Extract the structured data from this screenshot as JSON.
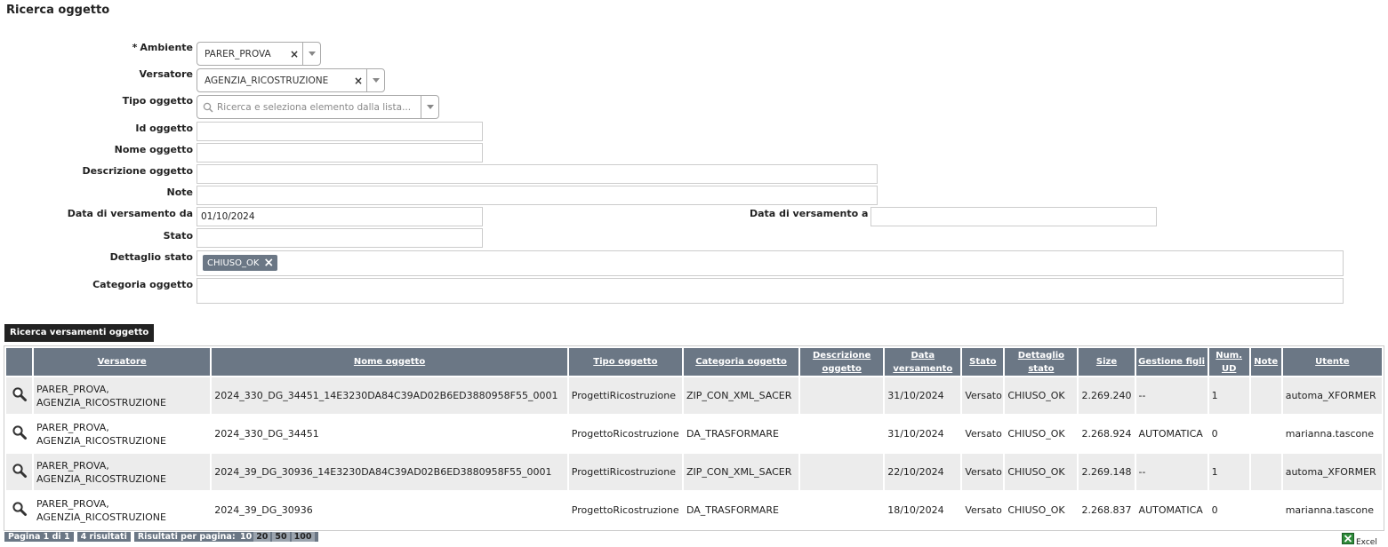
{
  "page": {
    "title": "Ricerca oggetto"
  },
  "form": {
    "ambiente": {
      "label": "Ambiente",
      "required_mark": "*",
      "value": "PARER_PROVA"
    },
    "versatore": {
      "label": "Versatore",
      "value": "AGENZIA_RICOSTRUZIONE"
    },
    "tipo_oggetto": {
      "label": "Tipo oggetto",
      "placeholder": "Ricerca e seleziona elemento dalla lista..."
    },
    "id_oggetto": {
      "label": "Id oggetto",
      "value": ""
    },
    "nome_oggetto": {
      "label": "Nome oggetto",
      "value": ""
    },
    "descrizione_oggetto": {
      "label": "Descrizione oggetto",
      "value": ""
    },
    "note": {
      "label": "Note",
      "value": ""
    },
    "data_da": {
      "label": "Data di versamento da",
      "value": "01/10/2024"
    },
    "data_a": {
      "label": "Data di versamento a",
      "value": ""
    },
    "stato": {
      "label": "Stato",
      "value": ""
    },
    "dettaglio_stato": {
      "label": "Dettaglio stato",
      "tags": [
        "CHIUSO_OK"
      ]
    },
    "categoria_oggetto": {
      "label": "Categoria oggetto",
      "value": ""
    }
  },
  "search_button": {
    "label": "Ricerca versamenti oggetto"
  },
  "table": {
    "columns": [
      "Versatore",
      "Nome oggetto",
      "Tipo oggetto",
      "Categoria oggetto",
      "Descrizione oggetto",
      "Data versamento",
      "Stato",
      "Dettaglio stato",
      "Size",
      "Gestione figli",
      "Num. UD",
      "Note",
      "Utente"
    ],
    "rows": [
      {
        "versatore_1": "PARER_PROVA,",
        "versatore_2": "AGENZIA_RICOSTRUZIONE",
        "nome": "2024_330_DG_34451_14E3230DA84C39AD02B6ED3880958F55_0001",
        "tipo": "ProgettiRicostruzione",
        "categoria": "ZIP_CON_XML_SACER",
        "descrizione": "",
        "data": "31/10/2024",
        "stato": "Versato",
        "dettaglio": "CHIUSO_OK",
        "size": "2.269.240",
        "gestione": "--",
        "num_ud": "1",
        "note": "",
        "utente": "automa_XFORMER"
      },
      {
        "versatore_1": "PARER_PROVA,",
        "versatore_2": "AGENZIA_RICOSTRUZIONE",
        "nome": "2024_330_DG_34451",
        "tipo": "ProgettoRicostruzione",
        "categoria": "DA_TRASFORMARE",
        "descrizione": "",
        "data": "31/10/2024",
        "stato": "Versato",
        "dettaglio": "CHIUSO_OK",
        "size": "2.268.924",
        "gestione": "AUTOMATICA",
        "num_ud": "0",
        "note": "",
        "utente": "marianna.tascone"
      },
      {
        "versatore_1": "PARER_PROVA,",
        "versatore_2": "AGENZIA_RICOSTRUZIONE",
        "nome": "2024_39_DG_30936_14E3230DA84C39AD02B6ED3880958F55_0001",
        "tipo": "ProgettiRicostruzione",
        "categoria": "ZIP_CON_XML_SACER",
        "descrizione": "",
        "data": "22/10/2024",
        "stato": "Versato",
        "dettaglio": "CHIUSO_OK",
        "size": "2.269.148",
        "gestione": "--",
        "num_ud": "1",
        "note": "",
        "utente": "automa_XFORMER"
      },
      {
        "versatore_1": "PARER_PROVA,",
        "versatore_2": "AGENZIA_RICOSTRUZIONE",
        "nome": "2024_39_DG_30936",
        "tipo": "ProgettoRicostruzione",
        "categoria": "DA_TRASFORMARE",
        "descrizione": "",
        "data": "18/10/2024",
        "stato": "Versato",
        "dettaglio": "CHIUSO_OK",
        "size": "2.268.837",
        "gestione": "AUTOMATICA",
        "num_ud": "0",
        "note": "",
        "utente": "marianna.tascone"
      }
    ]
  },
  "pager": {
    "page_info": "Pagina 1 di 1",
    "results": "4 risultati",
    "per_page_label": "Risultati per pagina:",
    "sizes": [
      "10",
      "20",
      "50",
      "100"
    ]
  },
  "export": {
    "label": "Excel",
    "icon": "excel-icon"
  },
  "colors": {
    "header_bg": "#6b7785",
    "row_alt": "#ececec",
    "button_bg": "#222222"
  }
}
